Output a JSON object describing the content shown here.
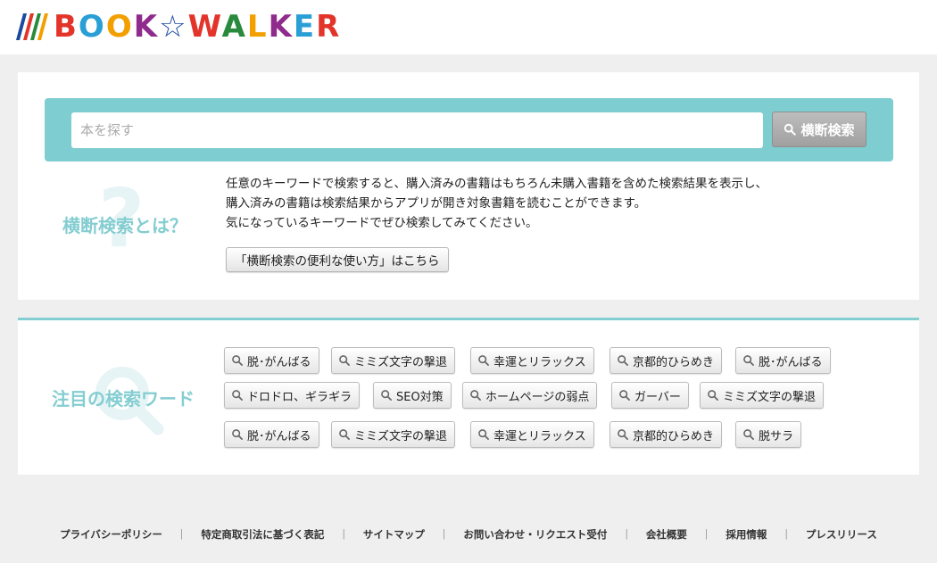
{
  "header": {
    "logo_text": "BOOK☆WALKER",
    "logo_bar_colors": [
      "#1a4aa0",
      "#e2342a",
      "#2a8a3c",
      "#f2a000",
      "#8e2b8c",
      "#2a9fd6"
    ],
    "logo_letter_colors": [
      "#e2342a",
      "#2a9fd6",
      "#f2a000",
      "#8e2b8c",
      "#1a4aa0",
      "#e2342a",
      "#2a8a3c",
      "#f2a000",
      "#8e2b8c",
      "#2a9fd6",
      "#e2342a"
    ]
  },
  "search": {
    "placeholder": "本を探す",
    "button_label": "横断検索"
  },
  "about": {
    "title": "横断検索とは？",
    "decor_glyph": "?",
    "lines": [
      "任意のキーワードで検索すると、購入済みの書籍はもちろん未購入書籍を含めた検索結果を表示し、",
      "購入済みの書籍は検索結果からアプリが開き対象書籍を読むことができます。",
      "気になっているキーワードでぜひ検索してみてください。"
    ],
    "guide_button": "「横断検索の便利な使い方」はこちら"
  },
  "keywords": {
    "title": "注目の検索ワード",
    "rows": [
      [
        "脱･がんばる",
        "ミミズ文字の撃退",
        "幸運とリラックス",
        "京都的ひらめき",
        "脱･がんばる"
      ],
      [
        "ドロドロ、ギラギラ",
        "SEO対策",
        "ホームページの弱点",
        "ガーバー",
        "ミミズ文字の撃退"
      ],
      [
        "脱･がんばる",
        "ミミズ文字の撃退",
        "幸運とリラックス",
        "京都的ひらめき",
        "脱サラ"
      ]
    ]
  },
  "footer": {
    "links": [
      "プライバシーポリシー",
      "特定商取引法に基づく表記",
      "サイトマップ",
      "お問い合わせ・リクエスト受付",
      "会社概要",
      "採用情報",
      "プレスリリース"
    ],
    "separator": "｜"
  },
  "colors": {
    "accent": "#7ecdd0",
    "page_bg": "#efefef"
  }
}
